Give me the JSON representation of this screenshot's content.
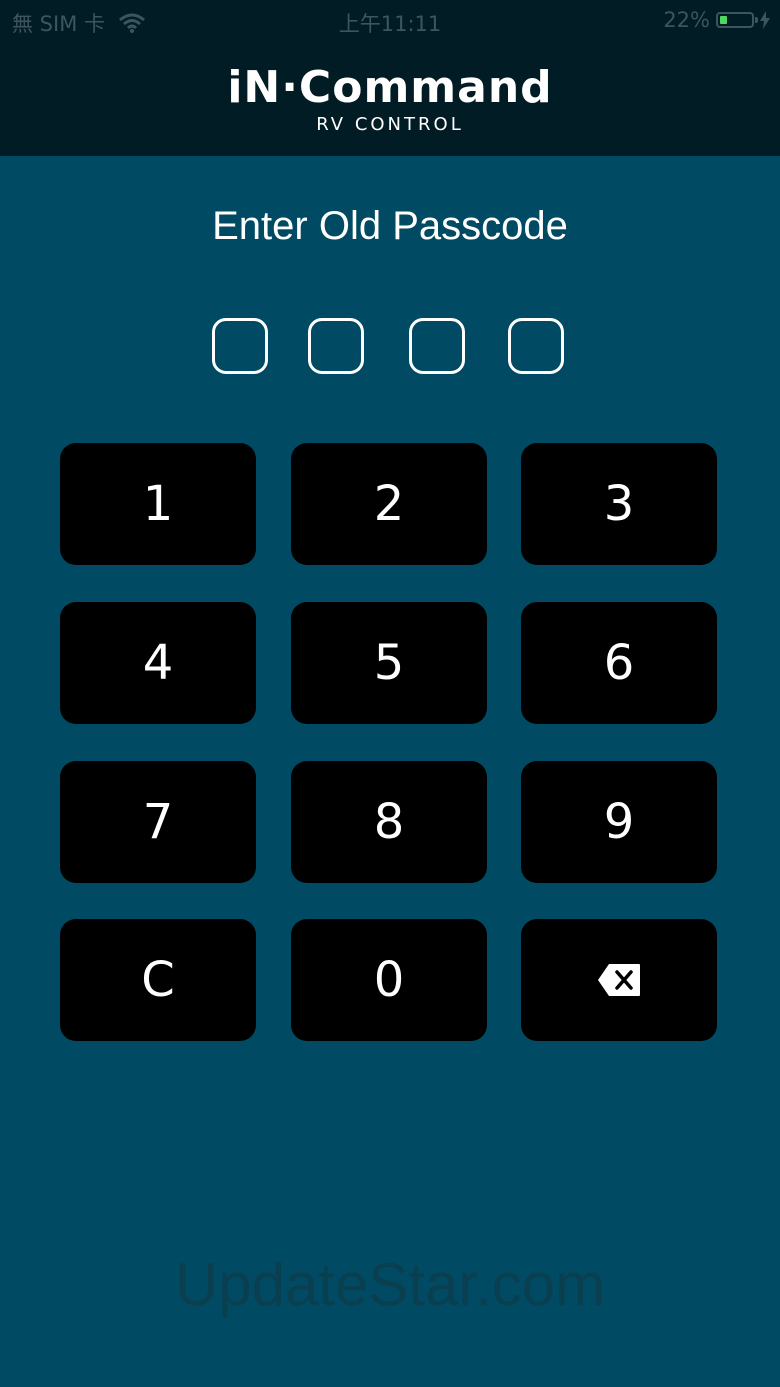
{
  "status_bar": {
    "carrier": "無 SIM 卡",
    "time": "上午11:11",
    "battery_percent": "22%",
    "battery_level": 0.22,
    "battery_color": "#4cd964"
  },
  "header": {
    "logo_main": "iN·Command",
    "logo_sub": "RV CONTROL"
  },
  "prompt": "Enter Old Passcode",
  "passcode": {
    "length": 4,
    "entered": 0
  },
  "keypad": {
    "keys": [
      "1",
      "2",
      "3",
      "4",
      "5",
      "6",
      "7",
      "8",
      "9",
      "C",
      "0",
      "backspace-icon"
    ]
  },
  "watermark": "UpdateStar.com",
  "colors": {
    "background": "#014a63",
    "header": "#021c25",
    "key": "#000000",
    "text": "#ffffff"
  }
}
